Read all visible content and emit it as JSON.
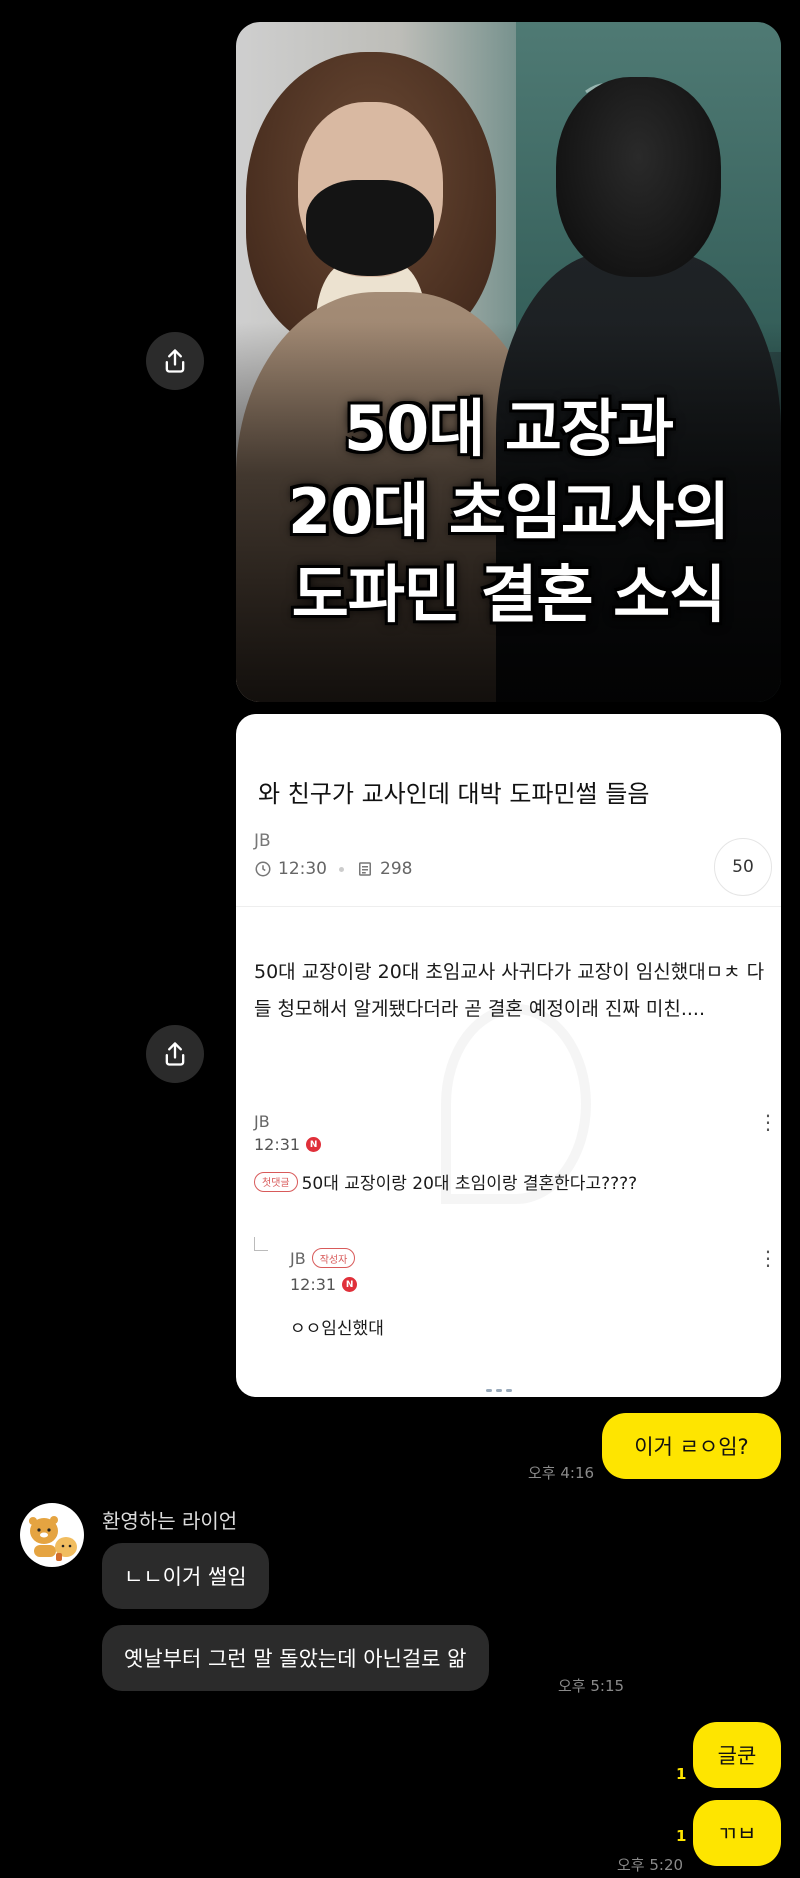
{
  "image_card": {
    "headline_lines": [
      "50대 교장과",
      "20대 초임교사의",
      "도파민 결혼 소식"
    ]
  },
  "post_card": {
    "title": "와 친구가 교사인데 대박 도파민썰 들음",
    "author": "JB",
    "time": "12:30",
    "views": "298",
    "comment_count": "50",
    "body": "50대 교장이랑 20대 초임교사 사귀다가 교장이 임신했대ㅁㅊ 다들 청모해서 알게됐다더라 곧 결혼 예정이래 진짜 미친....",
    "comments": [
      {
        "author": "JB",
        "time": "12:31",
        "badge": "N",
        "tag": "첫댓글",
        "text": "50대 교장이랑 20대 초임이랑 결혼한다고????"
      },
      {
        "author": "JB",
        "author_tag": "작성자",
        "time": "12:31",
        "badge": "N",
        "text": "ㅇㅇ임신했대"
      }
    ]
  },
  "messages": {
    "me_1": {
      "text": "이거 ㄹㅇ임?",
      "time": "오후 4:16"
    },
    "sender_name": "환영하는 라이언",
    "other_1": {
      "text": "ㄴㄴ이거 썰임"
    },
    "other_2": {
      "text": "옛날부터 그런 말 돌았는데 아닌걸로 앎",
      "time": "오후 5:15"
    },
    "me_2": {
      "text": "글쿤",
      "unread": "1"
    },
    "me_3": {
      "text": "ㄲㅂ",
      "unread": "1",
      "time": "오후 5:20"
    }
  },
  "icons": {
    "share": "share-icon",
    "clock": "clock-icon",
    "views": "document-icon",
    "more": "more-vertical-icon",
    "avatar": "ryan-character-avatar"
  },
  "colors": {
    "background": "#000000",
    "my_bubble": "#fee500",
    "other_bubble": "#2b2b2b",
    "badge_red": "#e0303a"
  }
}
